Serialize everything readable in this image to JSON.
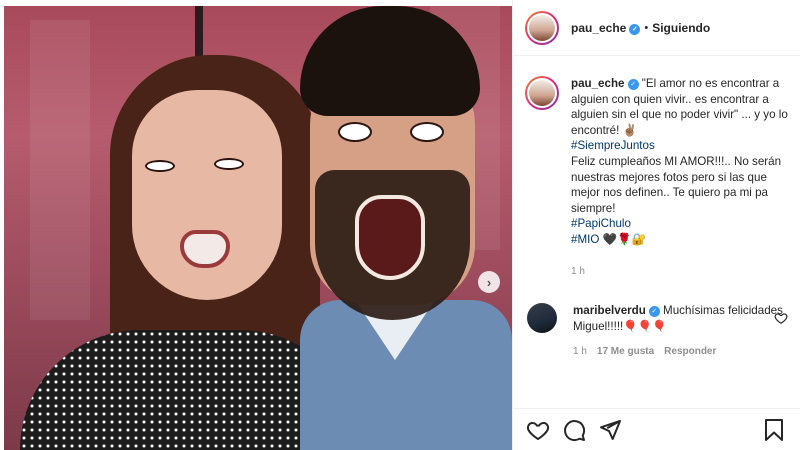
{
  "post": {
    "author": "pau_eche",
    "follow_status": "Siguiendo",
    "caption": {
      "author": "pau_eche",
      "quote": "\"El amor no es encontrar a alguien con quien vivir.. es encontrar a alguien sin el que no poder vivir\" ... y yo lo encontré! ✌🏽",
      "tag1": "#SiempreJuntos",
      "body": "Feliz cumpleaños MI AMOR!!!.. No serán nuestras mejores fotos pero si las que mejor nos definen.. Te quiero pa mi pa siempre!",
      "tag2": "#PapiChulo",
      "tag3": "#MIO",
      "tag3_emoji": "🖤🌹🔐",
      "time": "1 h"
    },
    "comment": {
      "author": "maribelverdu",
      "text": "Muchísimas felicidades Miguel!!!!!🎈🎈🎈",
      "time": "1 h",
      "likes": "17 Me gusta",
      "reply_label": "Responder"
    },
    "next_arrow": "›",
    "verified_mark": "✓",
    "dot": "•"
  },
  "icons": {
    "like": "heart-icon",
    "comment": "comment-icon",
    "share": "share-icon",
    "save": "bookmark-icon",
    "next": "chevron-right-icon"
  },
  "colors": {
    "link": "#00376b",
    "verified": "#3897f0",
    "muted": "#8e8e8e"
  }
}
